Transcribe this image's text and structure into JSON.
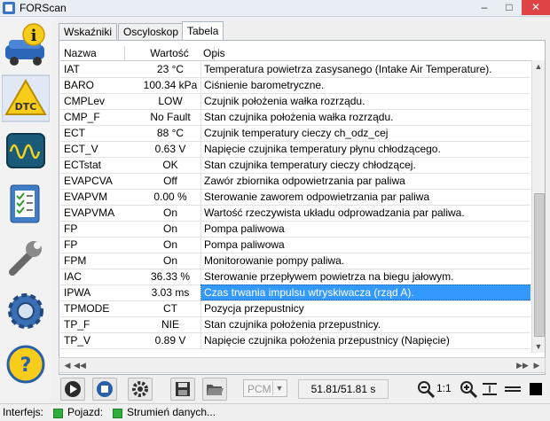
{
  "window": {
    "title": "FORScan",
    "minimize": "–",
    "maximize": "□",
    "close": "✕"
  },
  "sidebar": [
    {
      "name": "info-icon",
      "label": "i"
    },
    {
      "name": "dtc-icon",
      "label": "DTC"
    },
    {
      "name": "oscilloscope-icon"
    },
    {
      "name": "checklist-icon"
    },
    {
      "name": "wrench-icon"
    },
    {
      "name": "gear-icon"
    },
    {
      "name": "help-icon",
      "label": "?"
    }
  ],
  "tabs": [
    {
      "label": "Wskaźniki",
      "active": false
    },
    {
      "label": "Oscyloskop",
      "active": false
    },
    {
      "label": "Tabela",
      "active": true
    }
  ],
  "table": {
    "headers": {
      "name": "Nazwa",
      "value": "Wartość",
      "desc": "Opis"
    },
    "rows": [
      {
        "name": "IAT",
        "value": "23 °C",
        "desc": "Temperatura powietrza zasysanego (Intake Air Temperature)."
      },
      {
        "name": "BARO",
        "value": "100.34 kPa",
        "desc": "Ciśnienie barometryczne."
      },
      {
        "name": "CMPLev",
        "value": "LOW",
        "desc": "Czujnik położenia wałka rozrządu."
      },
      {
        "name": "CMP_F",
        "value": "No Fault",
        "desc": "Stan czujnika położenia wałka rozrządu."
      },
      {
        "name": "ECT",
        "value": "88 °C",
        "desc": "Czujnik temperatury cieczy ch_odz_cej"
      },
      {
        "name": "ECT_V",
        "value": "0.63 V",
        "desc": "Napięcie czujnika temperatury płynu chłodzącego."
      },
      {
        "name": "ECTstat",
        "value": "OK",
        "desc": "Stan czujnika temperatury cieczy chłodzącej."
      },
      {
        "name": "EVAPCVA",
        "value": "Off",
        "desc": "Zawór zbiornika odpowietrzania par paliwa"
      },
      {
        "name": "EVAPVM",
        "value": "0.00 %",
        "desc": "Sterowanie zaworem odpowietrzania par paliwa"
      },
      {
        "name": "EVAPVMA",
        "value": "On",
        "desc": "Wartość rzeczywista układu odprowadzania par paliwa."
      },
      {
        "name": "FP",
        "value": "On",
        "desc": "Pompa paliwowa"
      },
      {
        "name": "FP",
        "value": "On",
        "desc": "Pompa paliwowa"
      },
      {
        "name": "FPM",
        "value": "On",
        "desc": "Monitorowanie pompy paliwa."
      },
      {
        "name": "IAC",
        "value": "36.33 %",
        "desc": "Sterowanie przepływem powietrza na biegu jałowym."
      },
      {
        "name": "IPWA",
        "value": "3.03 ms",
        "desc": "Czas trwania impulsu wtryskiwacza (rząd A).",
        "selected": true
      },
      {
        "name": "TPMODE",
        "value": "CT",
        "desc": "Pozycja przepustnicy"
      },
      {
        "name": "TP_F",
        "value": "NIE",
        "desc": "Stan czujnika położenia przepustnicy."
      },
      {
        "name": "TP_V",
        "value": "0.89 V",
        "desc": "Napięcie czujnika położenia przepustnicy (Napięcie)"
      }
    ]
  },
  "toolbar": {
    "protocol": "PCM",
    "rate": "51.81/51.81 s",
    "zoom_label": "1:1"
  },
  "status": {
    "interfejs_label": "Interfejs:",
    "pojazd_label": "Pojazd:",
    "stream_label": "Strumień danych...",
    "led_color": "#2fae3b"
  }
}
